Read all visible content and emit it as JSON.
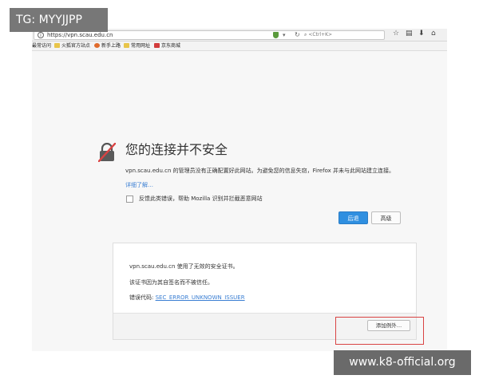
{
  "overlay": {
    "tg_badge": "TG: MYYJJPP",
    "watermark": "www.k8-official.org"
  },
  "browser": {
    "url": "https://vpn.scau.edu.cn",
    "search_placeholder": "<Ctrl+K>",
    "bookmarks": [
      {
        "label": "最常访问",
        "color": "#ffffff"
      },
      {
        "label": "火狐官方站点",
        "color": "#e8c54a"
      },
      {
        "label": "新手上路",
        "color": "#e06b2c"
      },
      {
        "label": "常用网址",
        "color": "#e8c54a"
      },
      {
        "label": "京东商城",
        "color": "#d23c3c"
      }
    ]
  },
  "error_page": {
    "title": "您的连接并不安全",
    "description": "vpn.scau.edu.cn 的管理员没有正确配置好此网站。为避免您的信息失窃，Firefox 并未与此网站建立连接。",
    "learn_more": "详细了解…",
    "report_label": "反馈此类错误，帮助 Mozilla 识别并拦截恶意网站",
    "back_button": "后退",
    "advanced_button": "高级"
  },
  "advanced": {
    "line1": "vpn.scau.edu.cn 使用了无效的安全证书。",
    "line2": "该证书因为其自签名而不被信任。",
    "error_code_label": "错误代码:",
    "error_code": "SEC_ERROR_UNKNOWN_ISSUER",
    "add_exception_button": "添加例外…"
  },
  "colors": {
    "accent_blue": "#2f8fe0",
    "highlight_red": "#d94343"
  }
}
